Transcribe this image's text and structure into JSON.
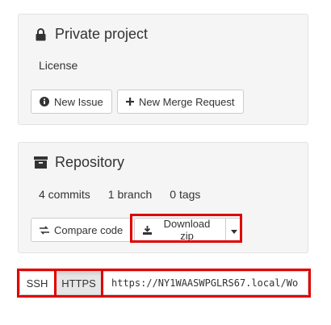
{
  "private_panel": {
    "title": "Private project",
    "license": "License",
    "new_issue_label": "New Issue",
    "new_mr_label": "New Merge Request"
  },
  "repo_panel": {
    "title": "Repository",
    "commits": "4 commits",
    "branches": "1 branch",
    "tags": "0 tags",
    "compare_label": "Compare code",
    "download_label": "Download zip"
  },
  "clone": {
    "ssh_label": "SSH",
    "https_label": "HTTPS",
    "url": "https://NY1WAASWPGLRS67.local/Wo"
  },
  "colors": {
    "highlight": "#e00000",
    "panel_bg": "#f5f5f5"
  },
  "icons": [
    "lock-icon",
    "info-icon",
    "plus-icon",
    "archive-icon",
    "exchange-icon",
    "download-icon",
    "caret-down-icon"
  ]
}
